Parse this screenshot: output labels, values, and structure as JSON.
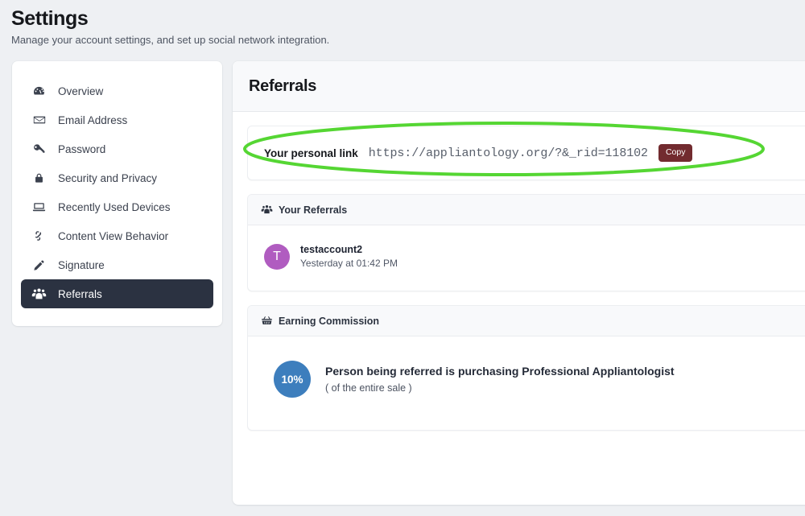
{
  "page": {
    "title": "Settings",
    "subtitle": "Manage your account settings, and set up social network integration."
  },
  "sidebar": {
    "items": [
      {
        "label": "Overview",
        "icon": "dashboard-icon",
        "active": false
      },
      {
        "label": "Email Address",
        "icon": "envelope-icon",
        "active": false
      },
      {
        "label": "Password",
        "icon": "key-icon",
        "active": false
      },
      {
        "label": "Security and Privacy",
        "icon": "lock-icon",
        "active": false
      },
      {
        "label": "Recently Used Devices",
        "icon": "laptop-icon",
        "active": false
      },
      {
        "label": "Content View Behavior",
        "icon": "link-icon",
        "active": false
      },
      {
        "label": "Signature",
        "icon": "pencil-icon",
        "active": false
      },
      {
        "label": "Referrals",
        "icon": "users-icon",
        "active": true
      }
    ]
  },
  "main": {
    "title": "Referrals",
    "personal_link": {
      "label": "Your personal link",
      "url": "https://appliantology.org/?&_rid=118102",
      "copy_label": "Copy",
      "copy_color": "#722b2f"
    },
    "your_referrals": {
      "header": "Your Referrals",
      "header_icon": "users-icon",
      "entries": [
        {
          "avatar_letter": "T",
          "avatar_color": "#b05cc0",
          "name": "testaccount2",
          "time": "Yesterday at 01:42 PM"
        }
      ]
    },
    "earning_commission": {
      "header": "Earning Commission",
      "header_icon": "basket-icon",
      "tiers": [
        {
          "percent": "10%",
          "badge_color": "#3d7ebd",
          "title": "Person being referred is purchasing Professional Appliantologist",
          "subtitle": "( of the entire sale )"
        }
      ]
    }
  },
  "annotation": {
    "shape": "ellipse",
    "color": "#55d633",
    "stroke_width": 4
  }
}
